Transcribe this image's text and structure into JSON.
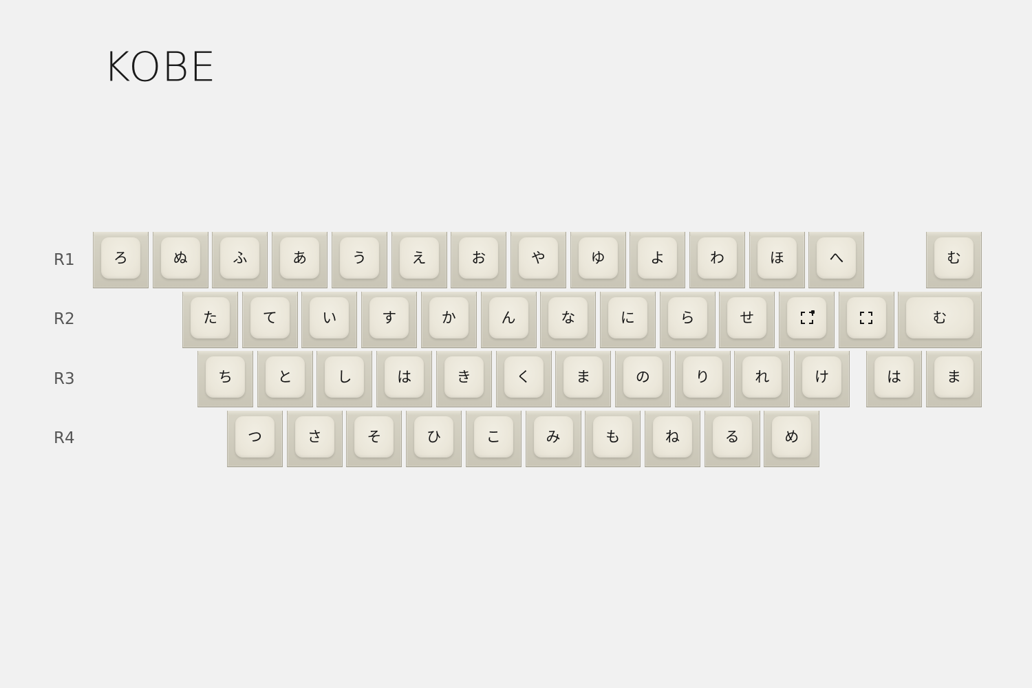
{
  "title": "KOBE",
  "rows": [
    {
      "label": "R1",
      "keys": [
        "ろ",
        "ぬ",
        "ふ",
        "あ",
        "う",
        "え",
        "お",
        "や",
        "ゆ",
        "よ",
        "わ",
        "ほ",
        "へ",
        "む"
      ]
    },
    {
      "label": "R2",
      "keys": [
        "た",
        "て",
        "い",
        "す",
        "か",
        "ん",
        "な",
        "に",
        "ら",
        "せ",
        "selection-icon",
        "selection-dotted-icon",
        "む"
      ]
    },
    {
      "label": "R3",
      "keys": [
        "ち",
        "と",
        "し",
        "は",
        "き",
        "く",
        "ま",
        "の",
        "り",
        "れ",
        "け",
        "は",
        "ま"
      ]
    },
    {
      "label": "R4",
      "keys": [
        "つ",
        "さ",
        "そ",
        "ひ",
        "こ",
        "み",
        "も",
        "ね",
        "る",
        "め"
      ]
    }
  ]
}
